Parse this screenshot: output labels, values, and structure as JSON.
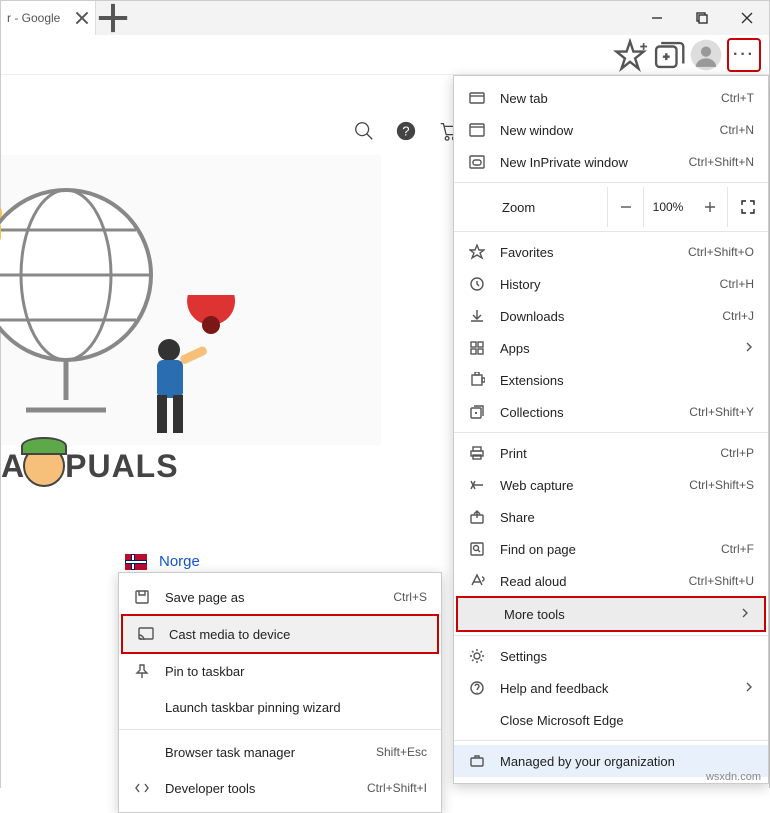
{
  "tab": {
    "title": "r - Google",
    "close": "×"
  },
  "window": {
    "min": "—",
    "max": "▭",
    "close": "✕"
  },
  "toolbar": {
    "more": "···"
  },
  "norge": "Norge",
  "submenu": {
    "save": {
      "label": "Save page as",
      "shortcut": "Ctrl+S"
    },
    "cast": {
      "label": "Cast media to device"
    },
    "pin": {
      "label": "Pin to taskbar"
    },
    "wizard": {
      "label": "Launch taskbar pinning wizard"
    },
    "taskmgr": {
      "label": "Browser task manager",
      "shortcut": "Shift+Esc"
    },
    "devtools": {
      "label": "Developer tools",
      "shortcut": "Ctrl+Shift+I"
    }
  },
  "menu": {
    "newtab": {
      "label": "New tab",
      "shortcut": "Ctrl+T"
    },
    "newwin": {
      "label": "New window",
      "shortcut": "Ctrl+N"
    },
    "inprivate": {
      "label": "New InPrivate window",
      "shortcut": "Ctrl+Shift+N"
    },
    "zoom": {
      "label": "Zoom",
      "value": "100%"
    },
    "favorites": {
      "label": "Favorites",
      "shortcut": "Ctrl+Shift+O"
    },
    "history": {
      "label": "History",
      "shortcut": "Ctrl+H"
    },
    "downloads": {
      "label": "Downloads",
      "shortcut": "Ctrl+J"
    },
    "apps": {
      "label": "Apps"
    },
    "extensions": {
      "label": "Extensions"
    },
    "collections": {
      "label": "Collections",
      "shortcut": "Ctrl+Shift+Y"
    },
    "print": {
      "label": "Print",
      "shortcut": "Ctrl+P"
    },
    "capture": {
      "label": "Web capture",
      "shortcut": "Ctrl+Shift+S"
    },
    "share": {
      "label": "Share"
    },
    "find": {
      "label": "Find on page",
      "shortcut": "Ctrl+F"
    },
    "readaloud": {
      "label": "Read aloud",
      "shortcut": "Ctrl+Shift+U"
    },
    "moretools": {
      "label": "More tools"
    },
    "settings": {
      "label": "Settings"
    },
    "help": {
      "label": "Help and feedback"
    },
    "close": {
      "label": "Close Microsoft Edge"
    },
    "managed": {
      "label": "Managed by your organization"
    }
  },
  "appuals": {
    "a1": "A",
    "rest": "PUALS"
  },
  "watermark": "wsxdn.com"
}
